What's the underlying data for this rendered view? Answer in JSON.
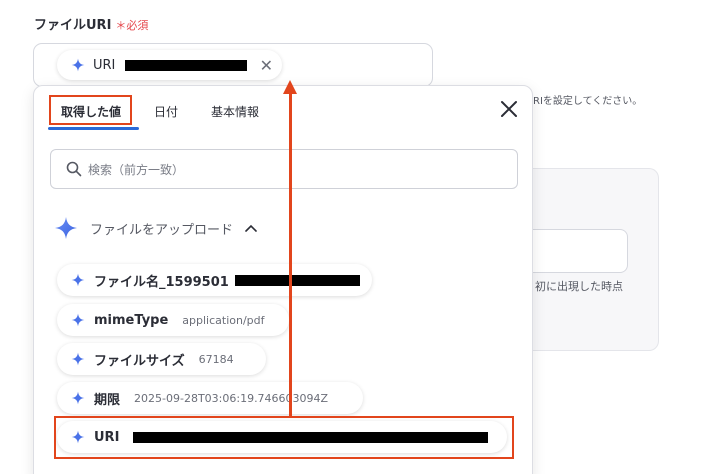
{
  "field": {
    "label": "ファイルURI",
    "required": "＊必須"
  },
  "uri_chip": {
    "label": "URI"
  },
  "background": {
    "hint": "RIを設定してください。",
    "note": "初に出現した時点"
  },
  "popup": {
    "tabs": [
      {
        "label": "取得した値"
      },
      {
        "label": "日付"
      },
      {
        "label": "基本情報"
      }
    ],
    "search": {
      "placeholder": "検索（前方一致）"
    },
    "section": {
      "title": "ファイルをアップロード"
    },
    "items": [
      {
        "name": "ファイル名_1599501",
        "value": ""
      },
      {
        "name": "mimeType",
        "value": "application/pdf"
      },
      {
        "name": "ファイルサイズ",
        "value": "67184"
      },
      {
        "name": "期限",
        "value": "2025-09-28T03:06:19.746603094Z"
      },
      {
        "name": "URI",
        "value": ""
      }
    ]
  },
  "colors": {
    "accent": "#2a6ad8",
    "annotation": "#e2451c",
    "required": "#e5484d"
  },
  "icons": {
    "sparkle": "sparkle-icon",
    "close": "close-icon",
    "search": "search-icon",
    "chevron": "chevron-up-icon"
  }
}
